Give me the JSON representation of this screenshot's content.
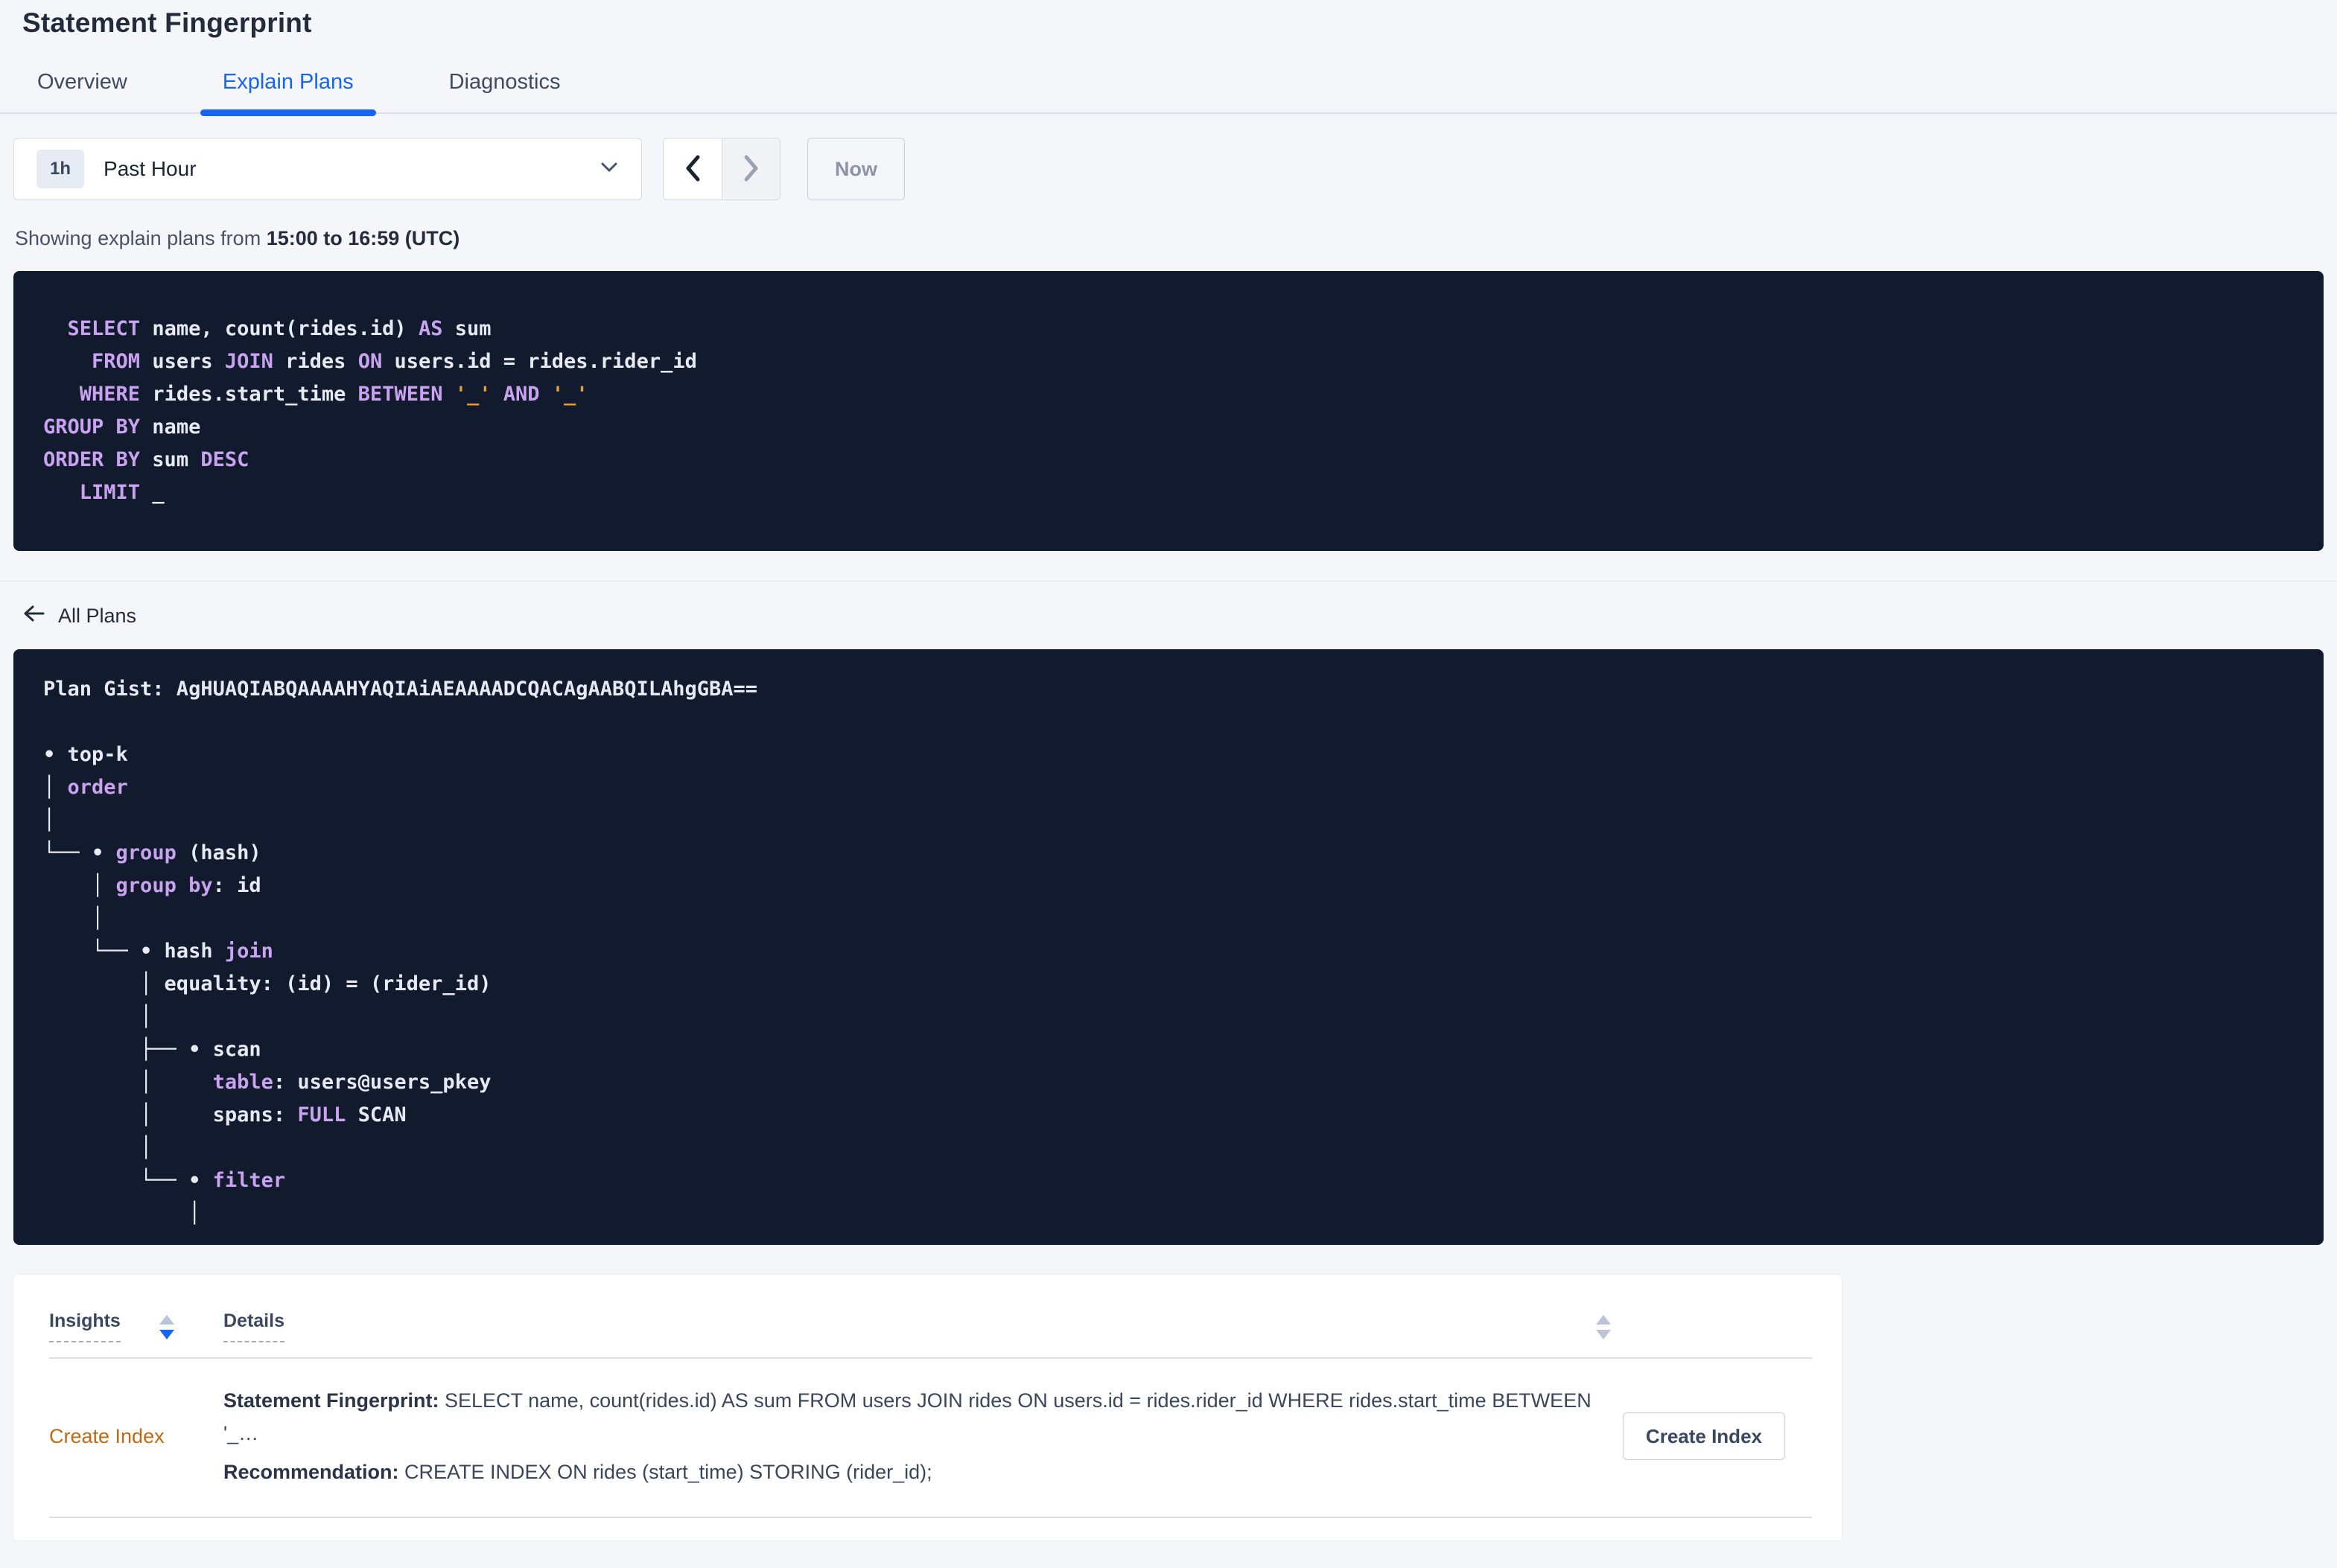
{
  "page": {
    "title": "Statement Fingerprint"
  },
  "tabs": [
    {
      "label": "Overview",
      "active": false
    },
    {
      "label": "Explain Plans",
      "active": true
    },
    {
      "label": "Diagnostics",
      "active": false
    }
  ],
  "time_picker": {
    "badge": "1h",
    "label": "Past Hour",
    "now_label": "Now"
  },
  "status_line": {
    "prefix": "Showing explain plans from ",
    "range": "15:00 to 16:59 (UTC)"
  },
  "colors": {
    "accent_blue": "#1664f0",
    "code_background": "#121a2d",
    "keyword_purple": "#c9a2f0",
    "string_orange": "#e39c3e",
    "insight_orange": "#bd6a13"
  },
  "sql_block": {
    "lines": [
      [
        {
          "t": "  "
        },
        {
          "t": "SELECT",
          "c": "k"
        },
        {
          "t": " name, count(rides.id) "
        },
        {
          "t": "AS",
          "c": "k"
        },
        {
          "t": " sum"
        }
      ],
      [
        {
          "t": "    "
        },
        {
          "t": "FROM",
          "c": "k"
        },
        {
          "t": " users "
        },
        {
          "t": "JOIN",
          "c": "k"
        },
        {
          "t": " rides "
        },
        {
          "t": "ON",
          "c": "k"
        },
        {
          "t": " users.id = rides.rider_id"
        }
      ],
      [
        {
          "t": "   "
        },
        {
          "t": "WHERE",
          "c": "k"
        },
        {
          "t": " rides.start_time "
        },
        {
          "t": "BETWEEN",
          "c": "k"
        },
        {
          "t": " "
        },
        {
          "t": "'_'",
          "c": "s"
        },
        {
          "t": " "
        },
        {
          "t": "AND",
          "c": "k"
        },
        {
          "t": " "
        },
        {
          "t": "'_'",
          "c": "s"
        }
      ],
      [
        {
          "t": "GROUP BY",
          "c": "k"
        },
        {
          "t": " name"
        }
      ],
      [
        {
          "t": "ORDER BY",
          "c": "k"
        },
        {
          "t": " sum "
        },
        {
          "t": "DESC",
          "c": "k"
        }
      ],
      [
        {
          "t": "   "
        },
        {
          "t": "LIMIT",
          "c": "k"
        },
        {
          "t": " _"
        }
      ]
    ]
  },
  "all_plans": {
    "label": "All Plans"
  },
  "plan_block": {
    "lines": [
      [
        {
          "t": "Plan Gist: AgHUAQIABQAAAAHYAQIAiAEAAAADCQACAgAABQILAhgGBA=="
        }
      ],
      [],
      [
        {
          "t": "• top-k"
        }
      ],
      [
        {
          "t": "│ "
        },
        {
          "t": "order",
          "c": "k"
        }
      ],
      [
        {
          "t": "│"
        }
      ],
      [
        {
          "t": "└── • "
        },
        {
          "t": "group",
          "c": "k"
        },
        {
          "t": " (hash)"
        }
      ],
      [
        {
          "t": "    │ "
        },
        {
          "t": "group by",
          "c": "k"
        },
        {
          "t": ": id"
        }
      ],
      [
        {
          "t": "    │"
        }
      ],
      [
        {
          "t": "    └── • hash "
        },
        {
          "t": "join",
          "c": "k"
        }
      ],
      [
        {
          "t": "        │ equality: (id) = (rider_id)"
        }
      ],
      [
        {
          "t": "        │"
        }
      ],
      [
        {
          "t": "        ├── • scan"
        }
      ],
      [
        {
          "t": "        │     "
        },
        {
          "t": "table",
          "c": "k"
        },
        {
          "t": ": users@users_pkey"
        }
      ],
      [
        {
          "t": "        │     spans: "
        },
        {
          "t": "FULL",
          "c": "k"
        },
        {
          "t": " SCAN"
        }
      ],
      [
        {
          "t": "        │"
        }
      ],
      [
        {
          "t": "        └── • "
        },
        {
          "t": "filter",
          "c": "k"
        }
      ],
      [
        {
          "t": "            │"
        }
      ]
    ]
  },
  "insights_table": {
    "columns": [
      {
        "label": "Insights"
      },
      {
        "label": "Details"
      }
    ],
    "rows": [
      {
        "insight": "Create Index",
        "fingerprint_label": "Statement Fingerprint:",
        "fingerprint": " SELECT name, count(rides.id) AS sum FROM users JOIN rides ON users.id = rides.rider_id WHERE rides.start_time BETWEEN '_…",
        "recommendation_label": "Recommendation:",
        "recommendation": " CREATE INDEX ON rides (start_time) STORING (rider_id);",
        "action_label": "Create Index"
      }
    ]
  }
}
